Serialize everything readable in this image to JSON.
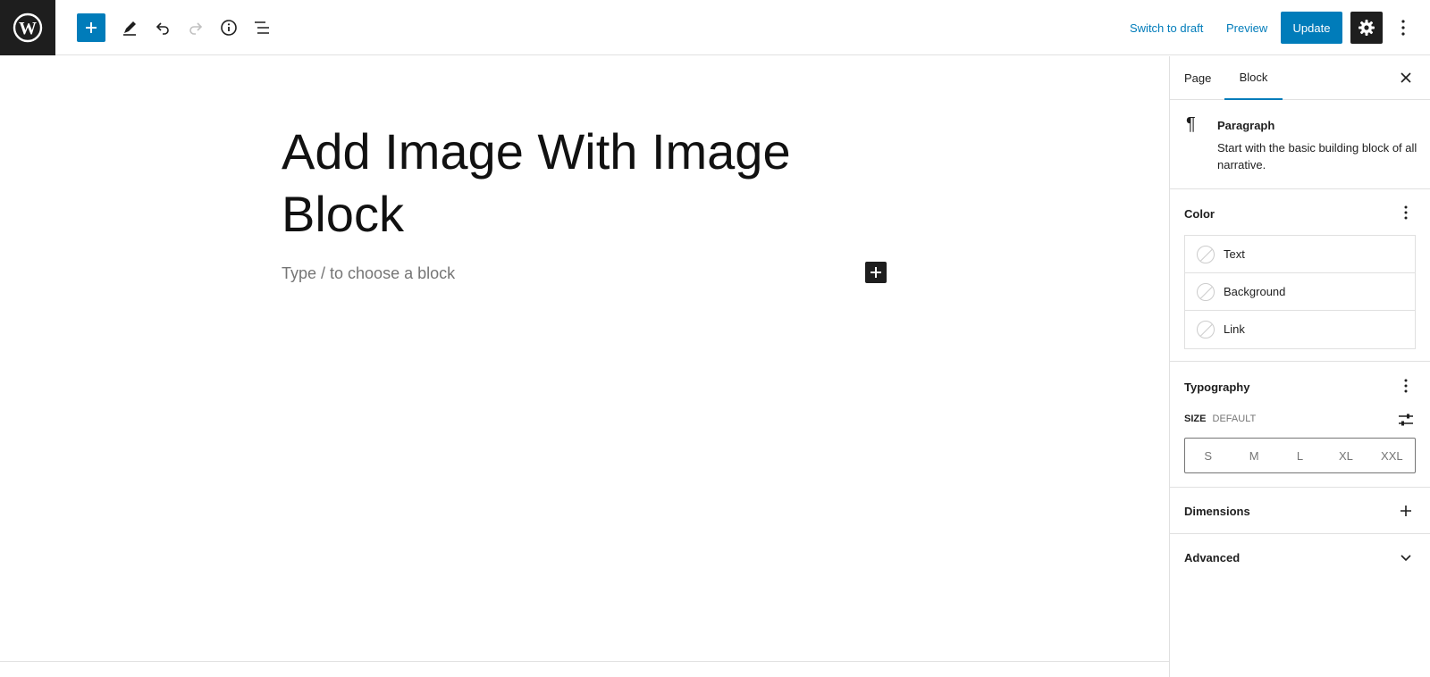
{
  "toolbar": {
    "logo_icon": "wordpress-logo-icon",
    "add_block_icon": "plus-icon",
    "tools_icon": "pencil-icon",
    "undo_icon": "undo-icon",
    "redo_icon": "redo-icon",
    "details_icon": "info-icon",
    "list_view_icon": "list-view-icon",
    "switch_to_draft": "Switch to draft",
    "preview": "Preview",
    "update": "Update",
    "settings_icon": "gear-icon",
    "options_icon": "more-vertical-icon"
  },
  "editor": {
    "title": "Add Image With Image Block",
    "placeholder": "Type / to choose a block"
  },
  "sidebar": {
    "tabs": [
      {
        "label": "Page",
        "active": false
      },
      {
        "label": "Block",
        "active": true
      }
    ],
    "block": {
      "name": "Paragraph",
      "description": "Start with the basic building block of all narrative."
    },
    "color": {
      "title": "Color",
      "items": [
        {
          "label": "Text"
        },
        {
          "label": "Background"
        },
        {
          "label": "Link"
        }
      ]
    },
    "typography": {
      "title": "Typography",
      "size_label": "Size",
      "size_value": "Default",
      "sizes": [
        "S",
        "M",
        "L",
        "XL",
        "XXL"
      ]
    },
    "dimensions": {
      "title": "Dimensions"
    },
    "advanced": {
      "title": "Advanced"
    }
  },
  "colors": {
    "accent": "#007cba",
    "dark": "#1e1e1e",
    "border": "#e0e0e0",
    "muted": "#757575"
  }
}
